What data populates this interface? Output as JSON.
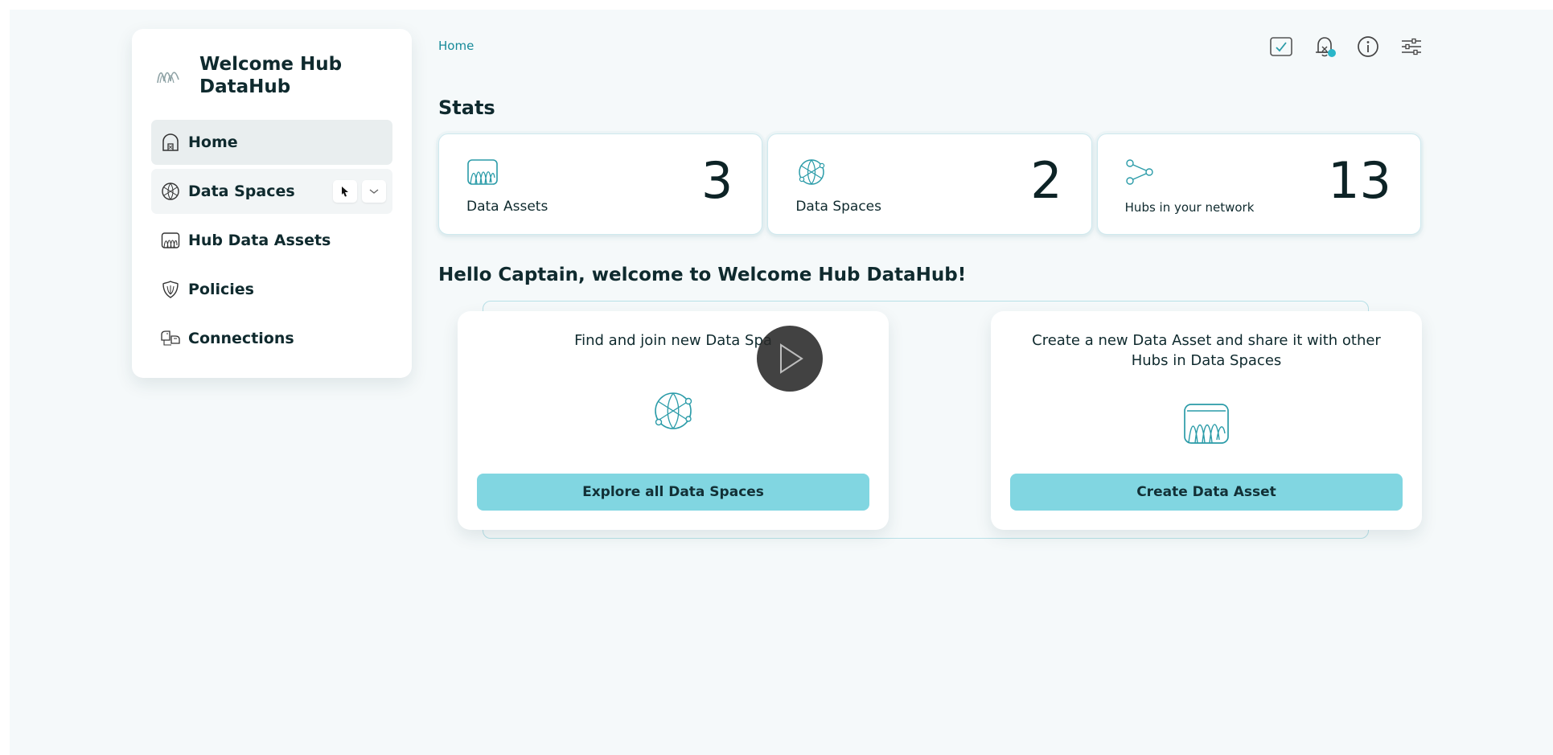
{
  "app": {
    "name": "Welcome Hub DataHub"
  },
  "sidebar": {
    "items": [
      {
        "label": "Home",
        "icon": "home-icon",
        "active": true
      },
      {
        "label": "Data Spaces",
        "icon": "globe-network-icon"
      },
      {
        "label": "Hub Data Assets",
        "icon": "data-asset-icon"
      },
      {
        "label": "Policies",
        "icon": "shield-icon"
      },
      {
        "label": "Connections",
        "icon": "connections-icon"
      }
    ]
  },
  "breadcrumb": {
    "current": "Home"
  },
  "top_icons": [
    "tasks-icon",
    "bell-icon",
    "info-icon",
    "settings-sliders-icon"
  ],
  "stats": {
    "title": "Stats",
    "cards": [
      {
        "label": "Data Assets",
        "value": "3",
        "icon": "data-asset-icon"
      },
      {
        "label": "Data Spaces",
        "value": "2",
        "icon": "globe-network-icon"
      },
      {
        "label": "Hubs in your network",
        "value": "13",
        "icon": "network-nodes-icon"
      }
    ]
  },
  "welcome": {
    "heading": "Hello Captain, welcome to Welcome Hub DataHub!",
    "cards": [
      {
        "text": "Find and join new Data Spa",
        "button": "Explore all Data Spaces",
        "icon": "globe-network-icon"
      },
      {
        "text": "Create a new Data Asset and share it with other Hubs in Data Spaces",
        "button": "Create Data Asset",
        "icon": "data-asset-icon"
      }
    ]
  },
  "colors": {
    "accent": "#81d6e1",
    "link": "#178a99",
    "icon": "#2a9ba8",
    "background": "#f5f9fa"
  }
}
